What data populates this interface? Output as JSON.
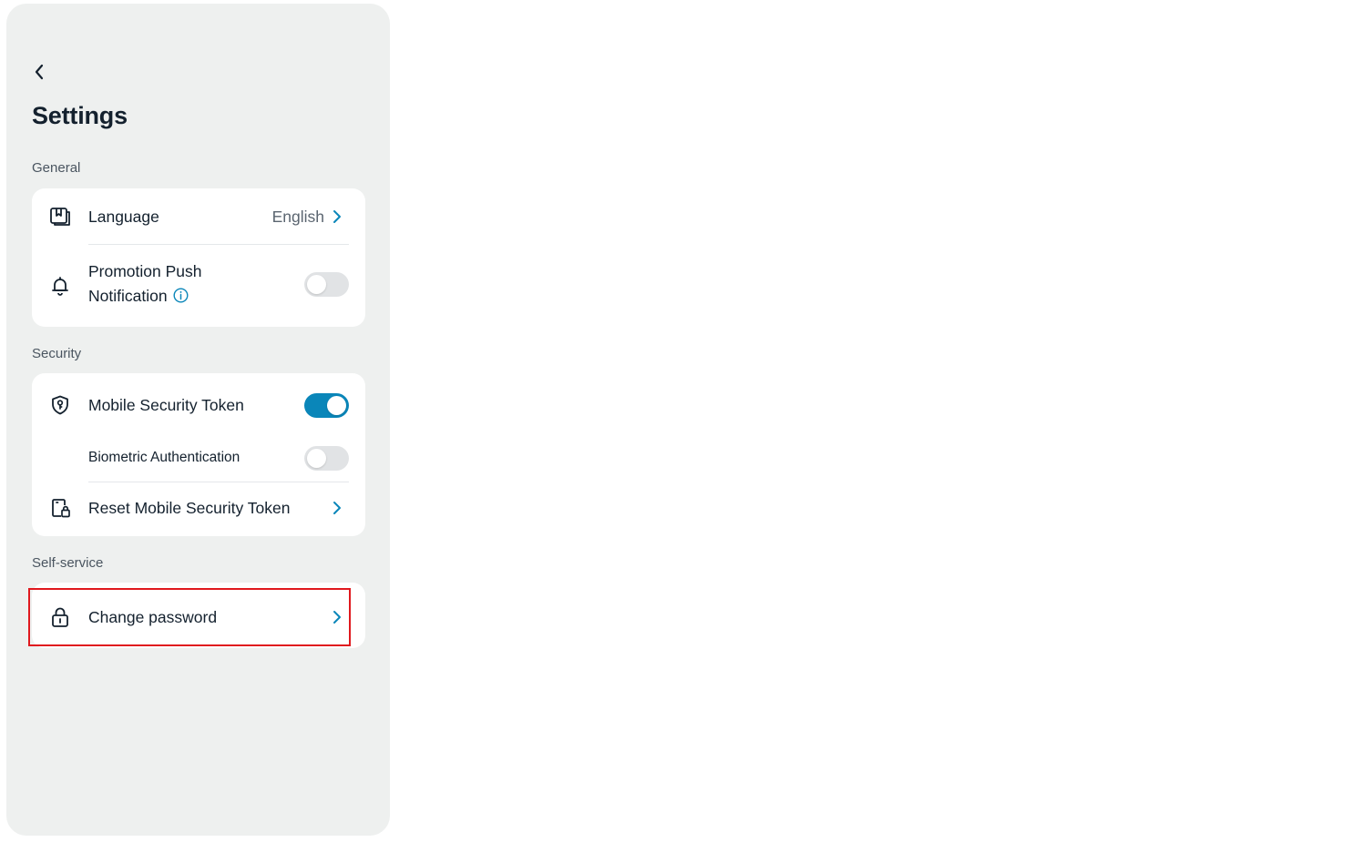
{
  "page": {
    "title": "Settings"
  },
  "sections": {
    "general": {
      "label": "General",
      "language": {
        "label": "Language",
        "value": "English"
      },
      "promotion": {
        "label_line1": "Promotion Push",
        "label_line2": "Notification",
        "enabled": false
      }
    },
    "security": {
      "label": "Security",
      "mobile_token": {
        "label": "Mobile Security Token",
        "enabled": true
      },
      "biometric": {
        "label": "Biometric Authentication",
        "enabled": false
      },
      "reset_token": {
        "label": "Reset Mobile Security Token"
      }
    },
    "self_service": {
      "label": "Self-service",
      "change_password": {
        "label": "Change password"
      }
    }
  },
  "colors": {
    "accent": "#0a86b9",
    "background": "#eef0ef",
    "highlight": "#e0191e"
  }
}
